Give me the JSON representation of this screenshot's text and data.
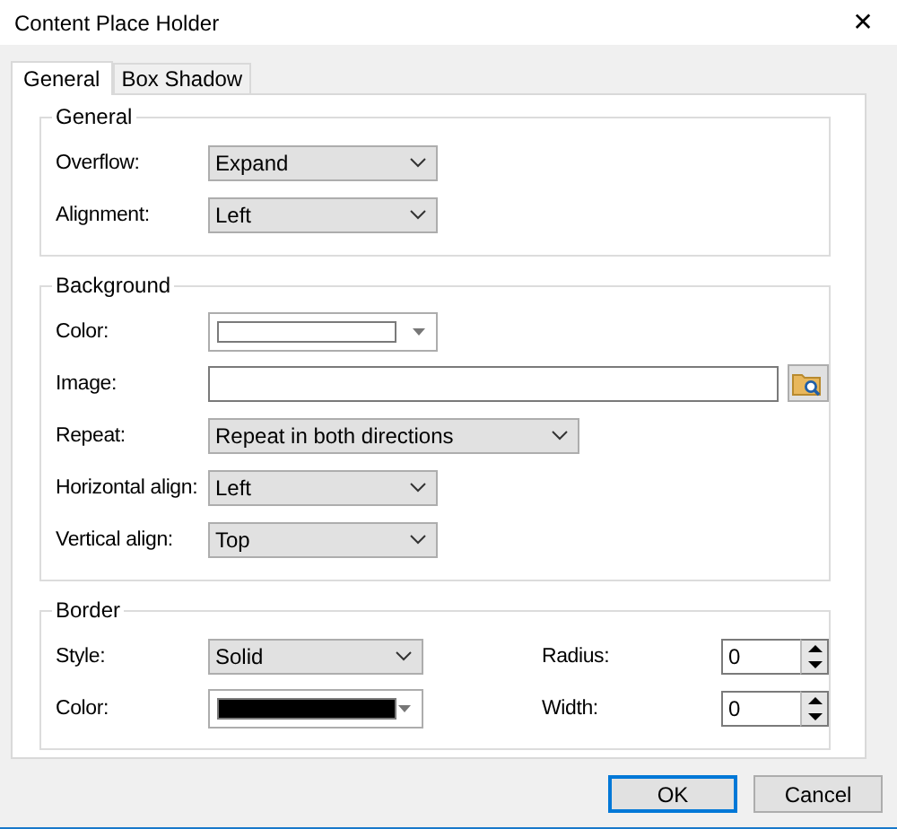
{
  "window": {
    "title": "Content Place Holder",
    "close": "✕"
  },
  "tabs": [
    {
      "label": "General",
      "selected": true
    },
    {
      "label": "Box Shadow",
      "selected": false
    }
  ],
  "groups": [
    {
      "title": "General",
      "rows": [
        [
          {
            "label": "Overflow:",
            "kind": "combo",
            "value": "Expand"
          }
        ],
        [
          {
            "label": "Alignment:",
            "kind": "combo",
            "value": "Left"
          }
        ]
      ]
    },
    {
      "title": "Background",
      "rows": [
        [
          {
            "label": "Color:",
            "kind": "color",
            "color": "#ffffff"
          }
        ],
        [
          {
            "label": "Image:",
            "kind": "file"
          }
        ],
        [
          {
            "label": "Repeat:",
            "kind": "long-combo",
            "value": "Repeat in both directions"
          }
        ],
        [
          {
            "label": "Horizontal align:",
            "kind": "combo",
            "value": "Left"
          }
        ],
        [
          {
            "label": "Vertical align:",
            "kind": "combo",
            "value": "Top"
          }
        ]
      ]
    },
    {
      "title": "Border",
      "rows": [
        [
          {
            "label": "Style:",
            "kind": "combo",
            "value": "Solid"
          },
          {
            "label": "Radius:",
            "kind": "spinner",
            "value": "0"
          }
        ],
        [
          {
            "label": "Color:",
            "kind": "color",
            "color": "#000000"
          },
          {
            "label": "Width:",
            "kind": "spinner",
            "value": "0"
          }
        ]
      ]
    }
  ],
  "buttons": [
    {
      "label": "OK",
      "default": true
    },
    {
      "label": "Cancel",
      "default": false
    }
  ]
}
